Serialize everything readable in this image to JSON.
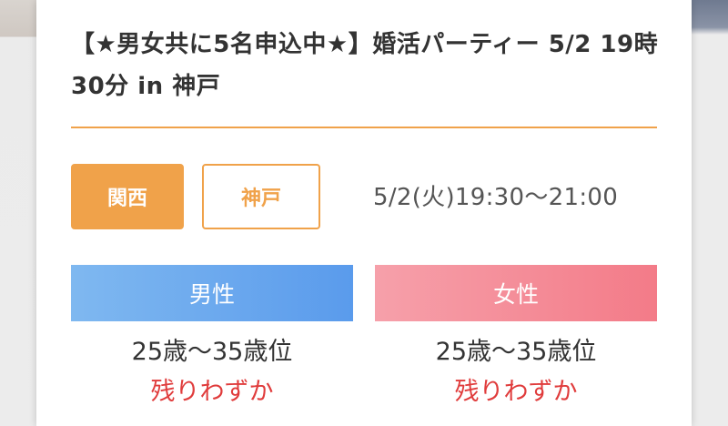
{
  "event": {
    "title": "【★男女共に5名申込中★】婚活パーティー 5/2 19時30分 in 神戸",
    "region_tag": "関西",
    "city_tag": "神戸",
    "datetime": "5/2(火)19:30〜21:00"
  },
  "colors": {
    "accent": "#f0a24a",
    "male": "#5a9bec",
    "female": "#f37b88",
    "remaining": "#e03c3c"
  },
  "male": {
    "label": "男性",
    "age_range": "25歳〜35歳位",
    "availability": "残りわずか"
  },
  "female": {
    "label": "女性",
    "age_range": "25歳〜35歳位",
    "availability": "残りわずか"
  }
}
